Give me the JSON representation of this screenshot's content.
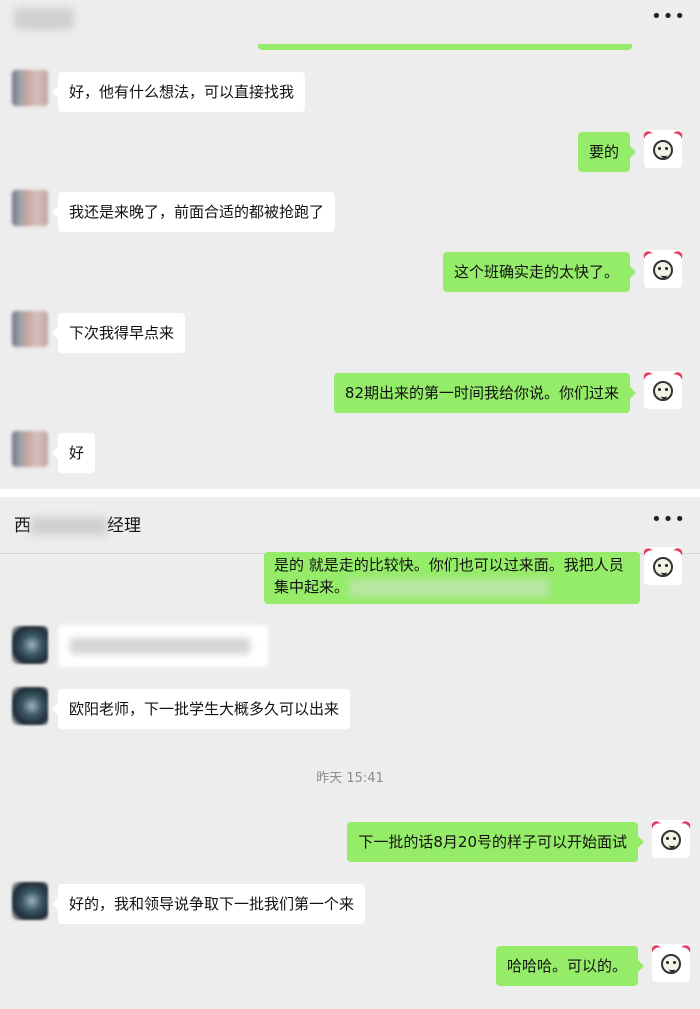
{
  "panel1": {
    "messages": [
      {
        "side": "left",
        "text": "好，他有什么想法，可以直接找我"
      },
      {
        "side": "right",
        "text": "要的"
      },
      {
        "side": "left",
        "text": "我还是来晚了，前面合适的都被抢跑了"
      },
      {
        "side": "right",
        "text": "这个班确实走的太快了。"
      },
      {
        "side": "left",
        "text": "下次我得早点来"
      },
      {
        "side": "right",
        "text": "82期出来的第一时间我给你说。你们过来"
      },
      {
        "side": "left",
        "text": "好"
      }
    ]
  },
  "panel2": {
    "header": {
      "title_prefix": "西",
      "title_suffix": "经理"
    },
    "top_message": "是的   就是走的比较快。你们也可以过来面。我把人员集中起来。",
    "messages": [
      {
        "side": "left",
        "text": "欧阳老师，下一批学生大概多久可以出来"
      },
      {
        "side": "right",
        "text": "下一批的话8月20号的样子可以开始面试"
      },
      {
        "side": "left",
        "text": "好的，我和领导说争取下一批我们第一个来"
      },
      {
        "side": "right",
        "text": "哈哈哈。可以的。"
      }
    ],
    "timestamp": "昨天 15:41"
  },
  "icons": {
    "more": "more-icon",
    "self_avatar": "cartoon-avatar-icon"
  },
  "colors": {
    "bg": "#ededed",
    "green_bubble": "#95ec69",
    "white_bubble": "#ffffff"
  }
}
